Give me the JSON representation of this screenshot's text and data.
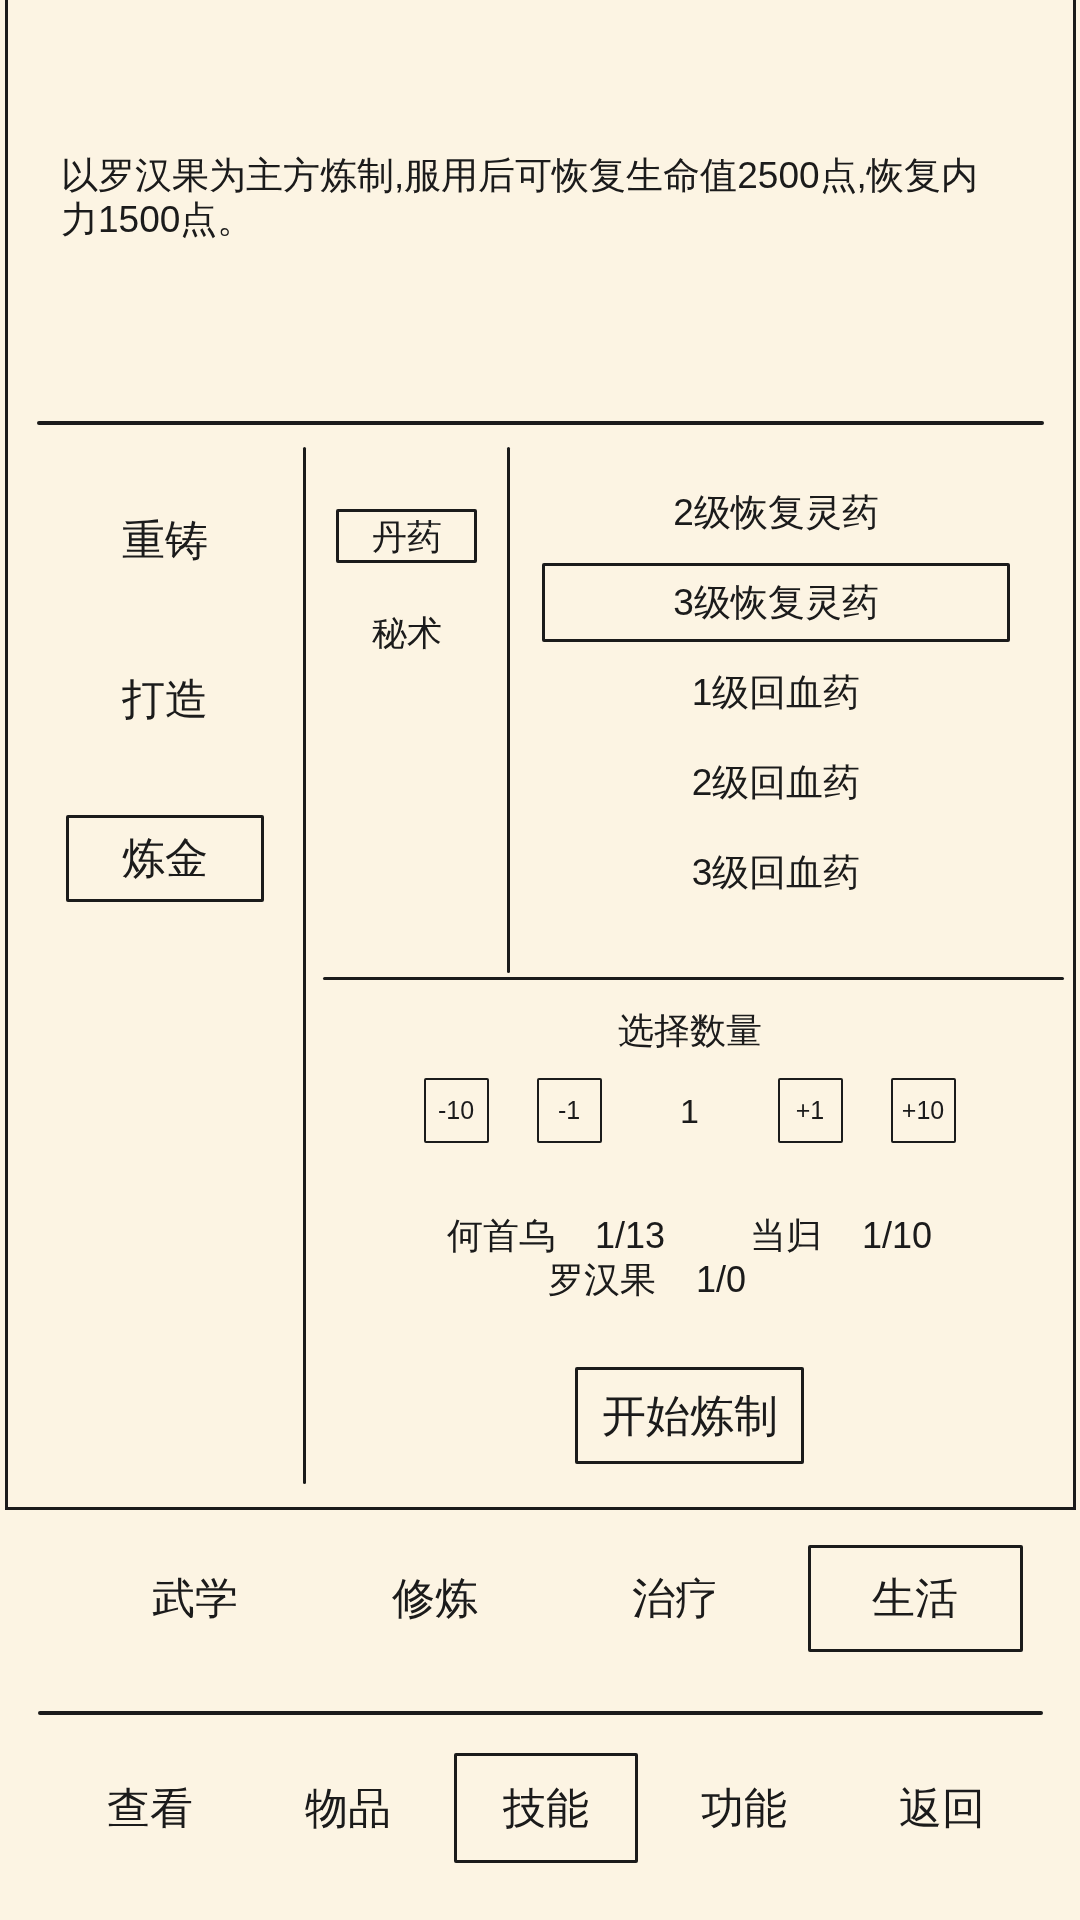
{
  "description": "以罗汉果为主方炼制,服用后可恢复生命值2500点,恢复内力1500点。",
  "crafts": [
    {
      "label": "重铸",
      "selected": false
    },
    {
      "label": "打造",
      "selected": false
    },
    {
      "label": "炼金",
      "selected": true
    }
  ],
  "categories": [
    {
      "label": "丹药",
      "selected": true
    },
    {
      "label": "秘术",
      "selected": false
    }
  ],
  "recipes": [
    {
      "label": "2级恢复灵药",
      "selected": false
    },
    {
      "label": "3级恢复灵药",
      "selected": true
    },
    {
      "label": "1级回血药",
      "selected": false
    },
    {
      "label": "2级回血药",
      "selected": false
    },
    {
      "label": "3级回血药",
      "selected": false
    }
  ],
  "quantity": {
    "title": "选择数量",
    "controls": [
      {
        "kind": "button",
        "text": "-10"
      },
      {
        "kind": "button",
        "text": "-1"
      },
      {
        "kind": "value",
        "text": "1"
      },
      {
        "kind": "button",
        "text": "+1"
      },
      {
        "kind": "button",
        "text": "+10"
      }
    ]
  },
  "materials": [
    {
      "name": "何首乌",
      "count": "1/13"
    },
    {
      "name": "当归",
      "count": "1/10"
    },
    {
      "name": "罗汉果",
      "count": "1/0"
    }
  ],
  "start_button": "开始炼制",
  "skill_tabs": [
    {
      "label": "武学",
      "selected": false
    },
    {
      "label": "修炼",
      "selected": false
    },
    {
      "label": "治疗",
      "selected": false
    },
    {
      "label": "生活",
      "selected": true
    }
  ],
  "bottom_nav": [
    {
      "label": "查看",
      "selected": false
    },
    {
      "label": "物品",
      "selected": false
    },
    {
      "label": "技能",
      "selected": true
    },
    {
      "label": "功能",
      "selected": false
    },
    {
      "label": "返回",
      "selected": false
    }
  ]
}
